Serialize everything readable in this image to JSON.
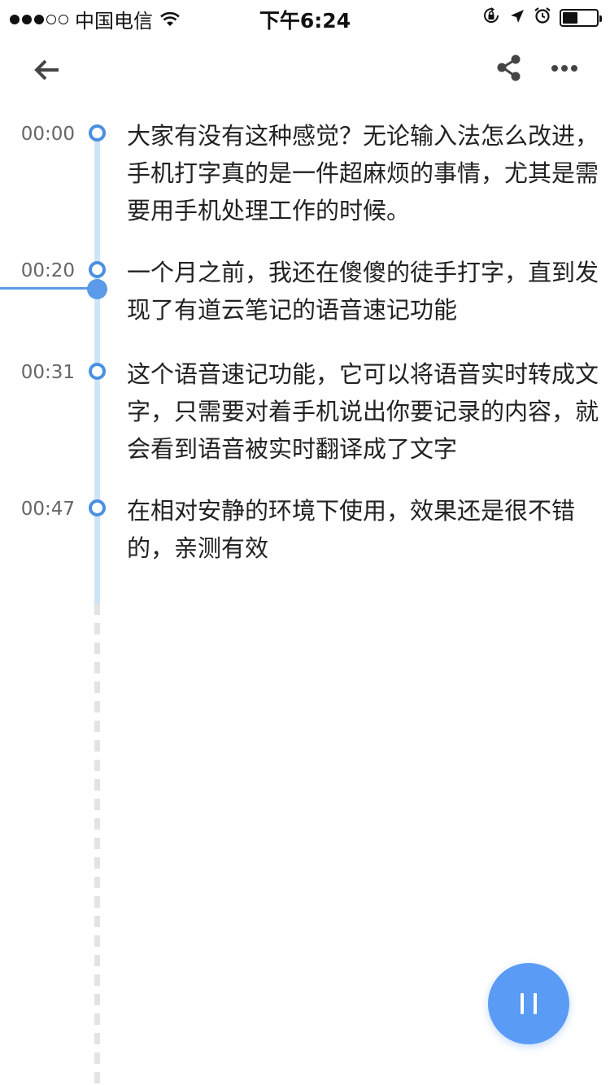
{
  "status_bar": {
    "carrier": "中国电信",
    "time": "下午6:24",
    "signal_dots_filled": 3,
    "signal_dots_total": 5,
    "battery_level": 0.45
  },
  "toolbar": {
    "back_icon": "arrow-left-icon",
    "share_icon": "share-icon",
    "more_icon": "more-horizontal-icon"
  },
  "entries": [
    {
      "time": "00:00",
      "text": "大家有没有这种感觉？无论输入法怎么改进，手机打字真的是一件超麻烦的事情，尤其是需要用手机处理工作的时候。"
    },
    {
      "time": "00:20",
      "text": "一个月之前，我还在傻傻的徒手打字，直到发现了有道云笔记的语音速记功能"
    },
    {
      "time": "00:31",
      "text": "这个语音速记功能，它可以将语音实时转成文字，只需要对着手机说出你要记录的内容，就会看到语音被实时翻译成了文字"
    },
    {
      "time": "00:47",
      "text": "在相对安静的环境下使用，效果还是很不错的，亲测有效"
    }
  ],
  "colors": {
    "accent": "#4a90e2",
    "timeline": "#cde5f8",
    "fab": "#5a9cf5"
  },
  "fab": {
    "icon": "pause-icon"
  }
}
